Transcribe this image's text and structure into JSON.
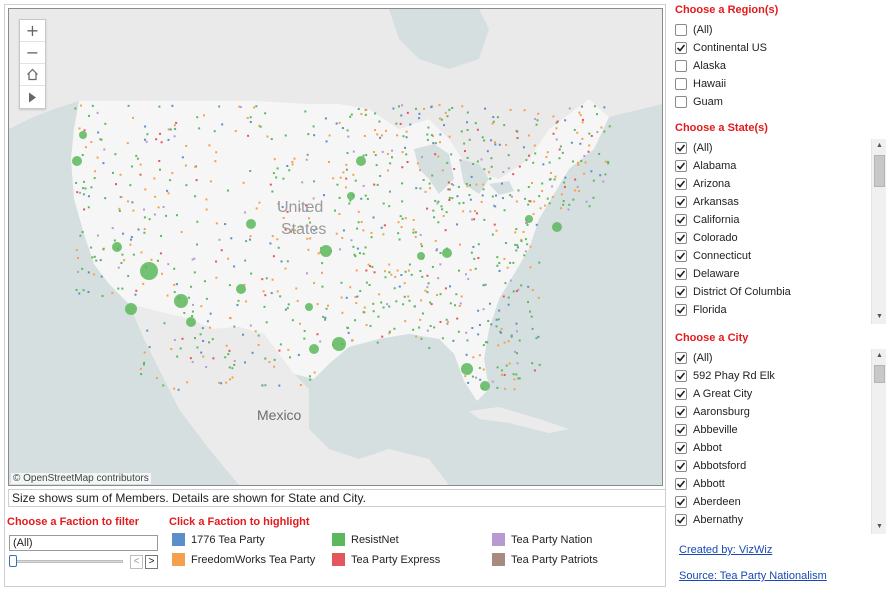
{
  "map": {
    "attribution": "© OpenStreetMap contributors",
    "labels": {
      "country_us_1": "United",
      "country_us_2": "States",
      "country_mexico": "Mexico"
    },
    "colors": {
      "water": "#d6dfe0",
      "land": "#ededed",
      "us_land": "#f7f7f7"
    },
    "controls": [
      "zoom-in-icon",
      "zoom-out-icon",
      "home-icon",
      "play-icon"
    ]
  },
  "caption": "Size shows sum of Members.  Details are shown for State and City.",
  "faction_filter": {
    "title": "Choose a Faction to filter",
    "selected": "(All)"
  },
  "faction_legend": {
    "title": "Click a Faction to highlight",
    "items": [
      {
        "label": "1776 Tea Party",
        "color": "#5b8fc9"
      },
      {
        "label": "ResistNet",
        "color": "#5cb85c"
      },
      {
        "label": "Tea Party Nation",
        "color": "#b79ad1"
      },
      {
        "label": "FreedomWorks Tea Party",
        "color": "#f5a04e"
      },
      {
        "label": "Tea Party Express",
        "color": "#e3575c"
      },
      {
        "label": "Tea Party Patriots",
        "color": "#a98a7f"
      }
    ]
  },
  "region_filter": {
    "title": "Choose a Region(s)",
    "items": [
      {
        "label": "(All)",
        "checked": false
      },
      {
        "label": "Continental US",
        "checked": true
      },
      {
        "label": "Alaska",
        "checked": false
      },
      {
        "label": "Hawaii",
        "checked": false
      },
      {
        "label": "Guam",
        "checked": false
      }
    ]
  },
  "state_filter": {
    "title": "Choose a State(s)",
    "items": [
      {
        "label": "(All)",
        "checked": true
      },
      {
        "label": "Alabama",
        "checked": true
      },
      {
        "label": "Arizona",
        "checked": true
      },
      {
        "label": "Arkansas",
        "checked": true
      },
      {
        "label": "California",
        "checked": true
      },
      {
        "label": "Colorado",
        "checked": true
      },
      {
        "label": "Connecticut",
        "checked": true
      },
      {
        "label": "Delaware",
        "checked": true
      },
      {
        "label": "District Of Columbia",
        "checked": true
      },
      {
        "label": "Florida",
        "checked": true
      }
    ]
  },
  "city_filter": {
    "title": "Choose a City",
    "items": [
      {
        "label": "(All)",
        "checked": true
      },
      {
        "label": "592 Phay Rd Elk",
        "checked": true
      },
      {
        "label": "A Great City",
        "checked": true
      },
      {
        "label": "Aaronsburg",
        "checked": true
      },
      {
        "label": "Abbeville",
        "checked": true
      },
      {
        "label": "Abbot",
        "checked": true
      },
      {
        "label": "Abbotsford",
        "checked": true
      },
      {
        "label": "Abbott",
        "checked": true
      },
      {
        "label": "Aberdeen",
        "checked": true
      },
      {
        "label": "Abernathy",
        "checked": true
      }
    ]
  },
  "links": {
    "created_by": "Created by: VizWiz",
    "source": "Source: Tea Party Nationalism"
  },
  "accent_color": "#e41a1c",
  "link_color": "#1a48b5"
}
